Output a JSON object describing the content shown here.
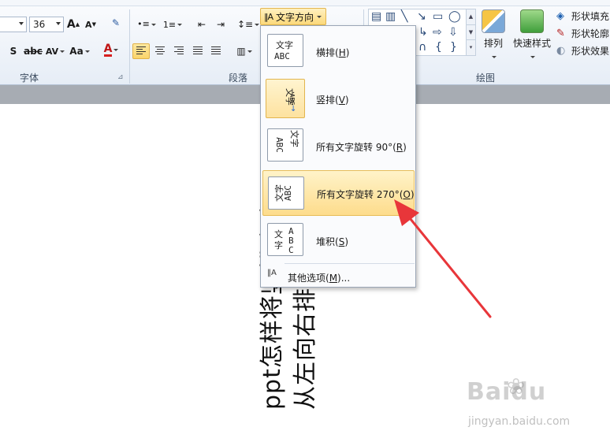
{
  "ribbon": {
    "font_group_label": "字体",
    "paragraph_group_label": "段落",
    "drawing_group_label": "绘图",
    "font_size_value": "36",
    "font_name_value": "",
    "text_direction_label": "文字方向",
    "arrange_label": "排列",
    "quick_styles_label": "快速样式",
    "shape_fill_label": "形状填充",
    "shape_outline_label": "形状轮廓",
    "shape_effects_label": "形状效果",
    "font_buttons": {
      "grow": "A",
      "shrink": "A",
      "shadow": "S",
      "strike": "abc",
      "spacing": "AV",
      "case": "Aa",
      "color": "A"
    }
  },
  "menu": {
    "items": [
      {
        "label": "横排(",
        "key": "H",
        "close": ")"
      },
      {
        "label": "竖排(",
        "key": "V",
        "close": ")"
      },
      {
        "label": "所有文字旋转 90°(",
        "key": "R",
        "close": ")"
      },
      {
        "label": "所有文字旋转 270°(",
        "key": "O",
        "close": ")"
      },
      {
        "label": "堆积(",
        "key": "S",
        "close": ")"
      }
    ],
    "more": {
      "label": "其他选项(",
      "key": "M",
      "close": ")..."
    }
  },
  "thumbs": {
    "horizontal": {
      "line1": "文字",
      "line2": "ABC"
    },
    "vertical": {
      "line1": "文字",
      "line2": "ABC"
    },
    "rot90": {
      "line1": "文字",
      "line2": "ABC"
    },
    "rot270": {
      "line1": "文字",
      "line2": "ABC"
    },
    "stacked": {
      "c1": "文",
      "c2": "字",
      "c3": "A",
      "c4": "B",
      "c5": "C"
    }
  },
  "slide": {
    "line1": "ppt怎样将竖排文字",
    "line2": "从左向右排"
  },
  "watermark": {
    "logo": "Baidu",
    "url": "jingyan.baidu.com"
  },
  "colors": {
    "accent": "#fcd97a",
    "arrow": "#e8363a",
    "font_color_bar": "#d61f1f"
  }
}
